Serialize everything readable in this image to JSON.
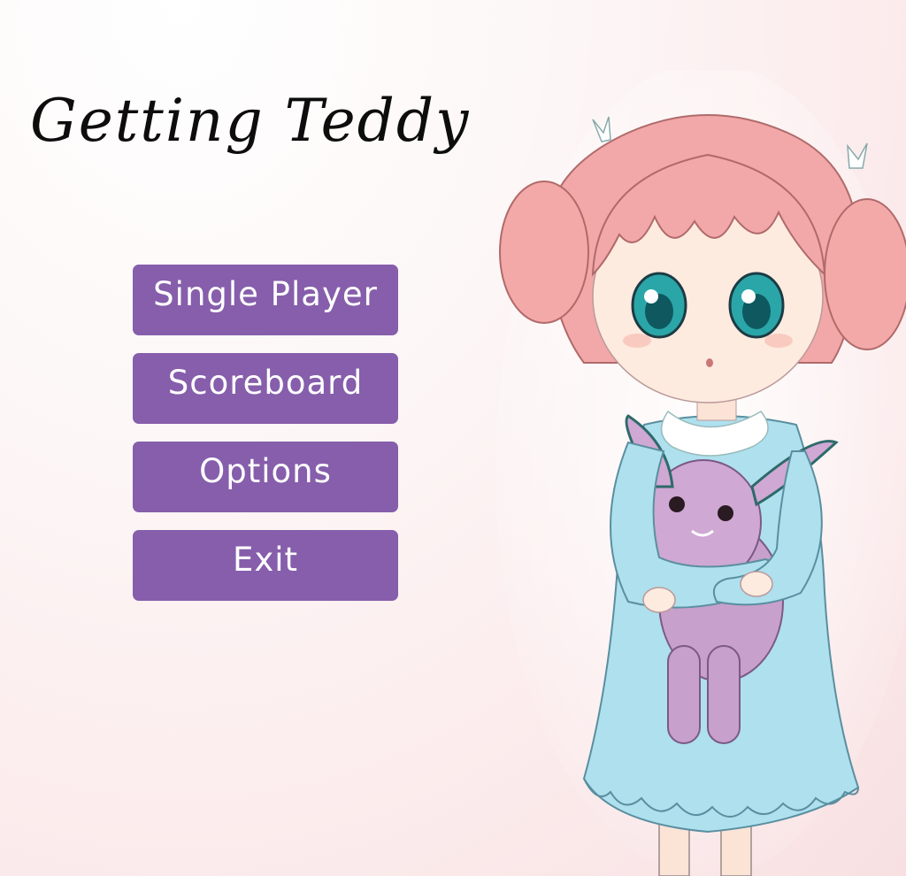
{
  "game": {
    "title": "Getting Teddy"
  },
  "menu": {
    "items": [
      {
        "label": "Single Player"
      },
      {
        "label": "Scoreboard"
      },
      {
        "label": "Options"
      },
      {
        "label": "Exit"
      }
    ]
  },
  "colors": {
    "button_background": "#865eab",
    "button_text": "#ffffff",
    "title_text": "#0d0d0d",
    "background_tint": "#fbe9ea",
    "hair": "#f2a8a8",
    "dress": "#aee0ee",
    "plush": "#c7a0cc"
  }
}
